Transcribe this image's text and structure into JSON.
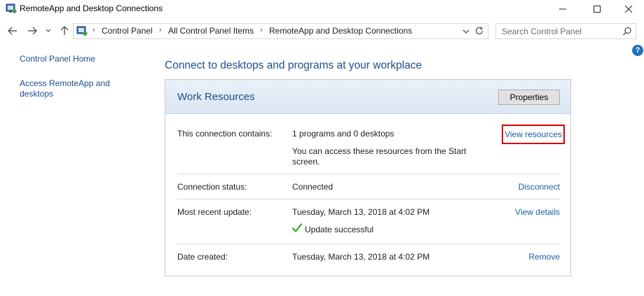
{
  "window": {
    "title": "RemoteApp and Desktop Connections"
  },
  "nav": {
    "breadcrumbs": [
      "Control Panel",
      "All Control Panel Items",
      "RemoteApp and Desktop Connections"
    ],
    "search_placeholder": "Search Control Panel"
  },
  "left_pane": {
    "home": "Control Panel Home",
    "access": "Access RemoteApp and desktops"
  },
  "main": {
    "heading": "Connect to desktops and programs at your workplace",
    "panel_title": "Work Resources",
    "properties_label": "Properties",
    "rows": {
      "contains_label": "This connection contains:",
      "contains_value": "1 programs and 0 desktops",
      "contains_note": "You can access these resources from the Start screen.",
      "contains_link": "View resources",
      "status_label": "Connection status:",
      "status_value": "Connected",
      "status_link": "Disconnect",
      "update_label": "Most recent update:",
      "update_value": "Tuesday, March 13, 2018 at 4:02 PM",
      "update_result": "Update successful",
      "update_link": "View details",
      "created_label": "Date created:",
      "created_value": "Tuesday, March 13, 2018 at 4:02 PM",
      "created_link": "Remove"
    }
  },
  "colors": {
    "link": "#1a5ea6",
    "heading": "#1f4f88",
    "highlight_box": "#d40000",
    "success_check": "#4caf3a"
  }
}
